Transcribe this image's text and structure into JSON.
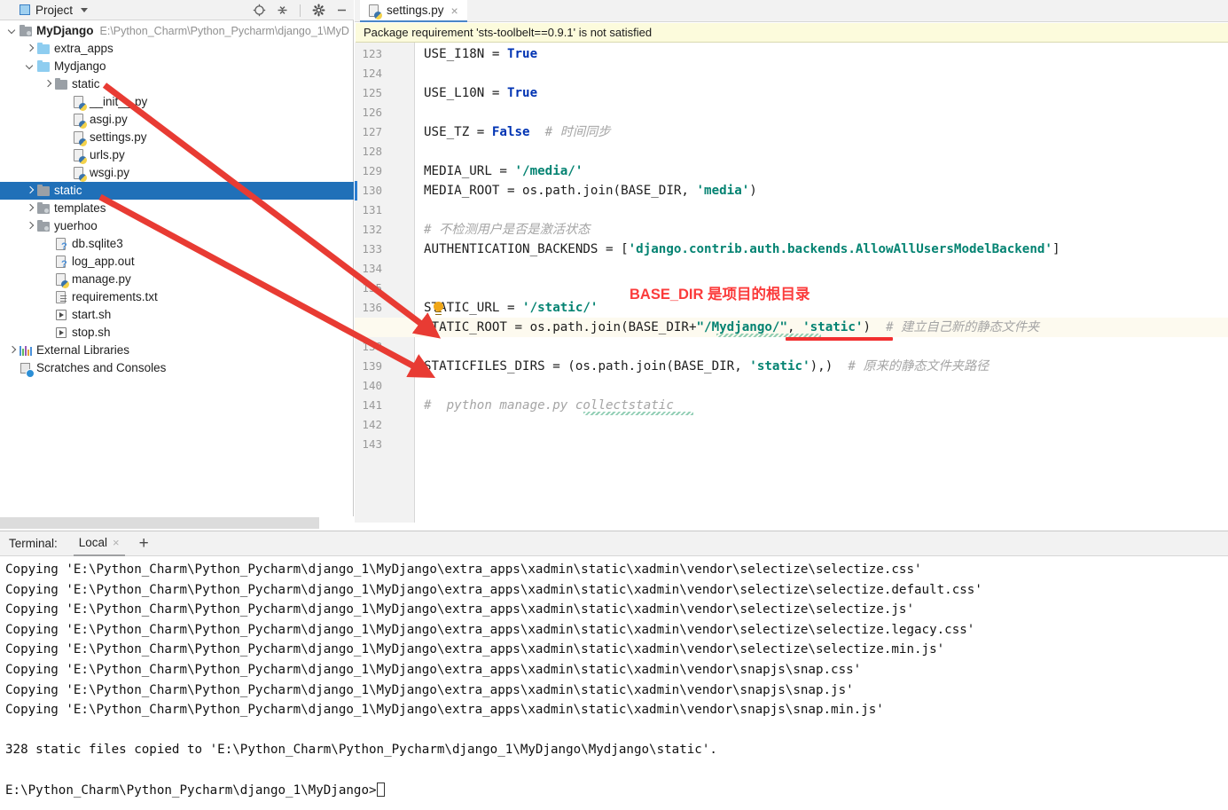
{
  "project_panel": {
    "title": "Project",
    "icons": [
      "locate-target-icon",
      "collapse-all-icon",
      "gear-icon",
      "minimize-icon"
    ],
    "root": {
      "name": "MyDjango",
      "path": "E:\\Python_Charm\\Python_Pycharm\\django_1\\MyD"
    },
    "tree": [
      {
        "label": "extra_apps",
        "indent": 1,
        "arrow": "right",
        "icon": "folder-blue-icon",
        "selected": false
      },
      {
        "label": "Mydjango",
        "indent": 1,
        "arrow": "down",
        "icon": "folder-blue-icon",
        "selected": false
      },
      {
        "label": "static",
        "indent": 2,
        "arrow": "right",
        "icon": "folder-gray-icon",
        "selected": false
      },
      {
        "label": "__init__.py",
        "indent": 3,
        "arrow": "none",
        "icon": "python-file-icon",
        "selected": false
      },
      {
        "label": "asgi.py",
        "indent": 3,
        "arrow": "none",
        "icon": "python-file-icon",
        "selected": false
      },
      {
        "label": "settings.py",
        "indent": 3,
        "arrow": "none",
        "icon": "python-file-icon",
        "selected": false
      },
      {
        "label": "urls.py",
        "indent": 3,
        "arrow": "none",
        "icon": "python-file-icon",
        "selected": false
      },
      {
        "label": "wsgi.py",
        "indent": 3,
        "arrow": "none",
        "icon": "python-file-icon",
        "selected": false
      },
      {
        "label": "static",
        "indent": 1,
        "arrow": "right",
        "icon": "folder-gray-icon",
        "selected": true
      },
      {
        "label": "templates",
        "indent": 1,
        "arrow": "right",
        "icon": "folder-source-icon",
        "selected": false
      },
      {
        "label": "yuerhoo",
        "indent": 1,
        "arrow": "right",
        "icon": "folder-source-icon",
        "selected": false
      },
      {
        "label": "db.sqlite3",
        "indent": 2,
        "arrow": "none",
        "icon": "unknown-file-icon",
        "selected": false
      },
      {
        "label": "log_app.out",
        "indent": 2,
        "arrow": "none",
        "icon": "unknown-file-icon",
        "selected": false
      },
      {
        "label": "manage.py",
        "indent": 2,
        "arrow": "none",
        "icon": "python-file-icon",
        "selected": false
      },
      {
        "label": "requirements.txt",
        "indent": 2,
        "arrow": "none",
        "icon": "text-file-icon",
        "selected": false
      },
      {
        "label": "start.sh",
        "indent": 2,
        "arrow": "none",
        "icon": "shell-file-icon",
        "selected": false
      },
      {
        "label": "stop.sh",
        "indent": 2,
        "arrow": "none",
        "icon": "shell-file-icon",
        "selected": false
      },
      {
        "label": "External Libraries",
        "indent": 0,
        "arrow": "right",
        "icon": "libraries-icon",
        "selected": false
      },
      {
        "label": "Scratches and Consoles",
        "indent": 0,
        "arrow": "none",
        "icon": "scratches-icon",
        "selected": false
      }
    ]
  },
  "editor": {
    "tab": {
      "label": "settings.py",
      "icon": "python-file-icon",
      "close": "×"
    },
    "warning": "Package requirement 'sts-toolbelt==0.9.1' is not satisfied",
    "lines": [
      {
        "n": "123",
        "segments": [
          {
            "t": "USE_I18N = ",
            "c": "fn"
          },
          {
            "t": "True",
            "c": "kw"
          }
        ]
      },
      {
        "n": "124",
        "segments": []
      },
      {
        "n": "125",
        "segments": [
          {
            "t": "USE_L10N = ",
            "c": "fn"
          },
          {
            "t": "True",
            "c": "kw"
          }
        ]
      },
      {
        "n": "126",
        "segments": []
      },
      {
        "n": "127",
        "segments": [
          {
            "t": "USE_TZ = ",
            "c": "fn"
          },
          {
            "t": "False",
            "c": "kw"
          },
          {
            "t": "  # ",
            "c": "cmt"
          },
          {
            "t": "时间同步",
            "c": "cmt"
          }
        ]
      },
      {
        "n": "128",
        "segments": []
      },
      {
        "n": "129",
        "segments": [
          {
            "t": "MEDIA_URL = ",
            "c": "fn"
          },
          {
            "t": "'/media/'",
            "c": "str"
          }
        ]
      },
      {
        "n": "130",
        "segments": [
          {
            "t": "MEDIA_ROOT = os.path.join(BASE_DIR, ",
            "c": "fn"
          },
          {
            "t": "'media'",
            "c": "str"
          },
          {
            "t": ")",
            "c": "fn"
          }
        ]
      },
      {
        "n": "131",
        "segments": []
      },
      {
        "n": "132",
        "segments": [
          {
            "t": "# ",
            "c": "cmt"
          },
          {
            "t": "不检测用户是否是激活状态",
            "c": "cmt"
          }
        ]
      },
      {
        "n": "133",
        "segments": [
          {
            "t": "AUTHENTICATION_BACKENDS = [",
            "c": "fn"
          },
          {
            "t": "'django.contrib.auth.backends.AllowAllUsersModelBackend'",
            "c": "str"
          },
          {
            "t": "]",
            "c": "fn"
          }
        ]
      },
      {
        "n": "134",
        "segments": []
      },
      {
        "n": "135",
        "segments": []
      },
      {
        "n": "136",
        "segments": [
          {
            "t": "STATIC_URL = ",
            "c": "fn"
          },
          {
            "t": "'/static/'",
            "c": "str"
          }
        ]
      },
      {
        "n": "137",
        "segments": [
          {
            "t": "STATIC_ROOT = os.path.join(BASE_DIR+",
            "c": "fn"
          },
          {
            "t": "\"/Mydjango/\"",
            "c": "str"
          },
          {
            "t": ", ",
            "c": "fn"
          },
          {
            "t": "'static'",
            "c": "str"
          },
          {
            "t": ")  ",
            "c": "fn"
          },
          {
            "t": "# ",
            "c": "cmt"
          },
          {
            "t": "建立自己新的静态文件夹",
            "c": "cmt"
          }
        ]
      },
      {
        "n": "138",
        "segments": []
      },
      {
        "n": "139",
        "segments": [
          {
            "t": "STATICFILES_DIRS = (os.path.join(BASE_DIR, ",
            "c": "fn"
          },
          {
            "t": "'static'",
            "c": "str"
          },
          {
            "t": "),)  ",
            "c": "fn"
          },
          {
            "t": "# ",
            "c": "cmt"
          },
          {
            "t": "原来的静态文件夹路径",
            "c": "cmt"
          }
        ]
      },
      {
        "n": "140",
        "segments": []
      },
      {
        "n": "141",
        "segments": [
          {
            "t": "#  python manage.py collectstatic",
            "c": "cmt"
          }
        ]
      },
      {
        "n": "142",
        "segments": []
      },
      {
        "n": "143",
        "segments": []
      }
    ],
    "annotation": {
      "text": "BASE_DIR 是项目的根目录",
      "color": "#fb3b3b"
    },
    "highlight_color": "#fdfaef",
    "arrow_color": "#e83b33"
  },
  "terminal": {
    "title": "Terminal:",
    "tab_label": "Local",
    "tab_close": "×",
    "add_label": "+",
    "lines": [
      "Copying 'E:\\Python_Charm\\Python_Pycharm\\django_1\\MyDjango\\extra_apps\\xadmin\\static\\xadmin\\vendor\\selectize\\selectize.css'",
      "Copying 'E:\\Python_Charm\\Python_Pycharm\\django_1\\MyDjango\\extra_apps\\xadmin\\static\\xadmin\\vendor\\selectize\\selectize.default.css'",
      "Copying 'E:\\Python_Charm\\Python_Pycharm\\django_1\\MyDjango\\extra_apps\\xadmin\\static\\xadmin\\vendor\\selectize\\selectize.js'",
      "Copying 'E:\\Python_Charm\\Python_Pycharm\\django_1\\MyDjango\\extra_apps\\xadmin\\static\\xadmin\\vendor\\selectize\\selectize.legacy.css'",
      "Copying 'E:\\Python_Charm\\Python_Pycharm\\django_1\\MyDjango\\extra_apps\\xadmin\\static\\xadmin\\vendor\\selectize\\selectize.min.js'",
      "Copying 'E:\\Python_Charm\\Python_Pycharm\\django_1\\MyDjango\\extra_apps\\xadmin\\static\\xadmin\\vendor\\snapjs\\snap.css'",
      "Copying 'E:\\Python_Charm\\Python_Pycharm\\django_1\\MyDjango\\extra_apps\\xadmin\\static\\xadmin\\vendor\\snapjs\\snap.js'",
      "Copying 'E:\\Python_Charm\\Python_Pycharm\\django_1\\MyDjango\\extra_apps\\xadmin\\static\\xadmin\\vendor\\snapjs\\snap.min.js'",
      "",
      "328 static files copied to 'E:\\Python_Charm\\Python_Pycharm\\django_1\\MyDjango\\Mydjango\\static'.",
      "",
      "E:\\Python_Charm\\Python_Pycharm\\django_1\\MyDjango>"
    ]
  }
}
